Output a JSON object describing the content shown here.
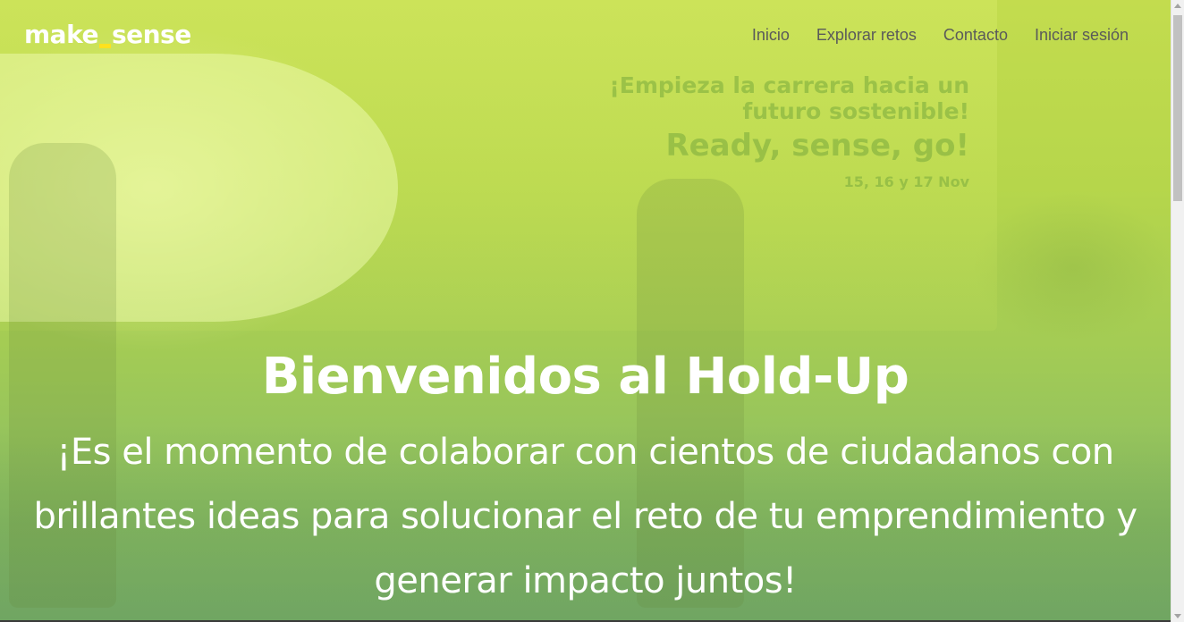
{
  "header": {
    "logo": {
      "part1": "make",
      "part2": "sense"
    },
    "nav": [
      {
        "label": "Inicio"
      },
      {
        "label": "Explorar retos"
      },
      {
        "label": "Contacto"
      },
      {
        "label": "Iniciar sesión"
      }
    ]
  },
  "hero": {
    "title": "Bienvenidos al Hold-Up",
    "subtitle": "¡Es el momento de colaborar con cientos de ciudadanos con brillantes ideas para solucionar el reto de tu emprendimiento y generar impacto juntos!",
    "background_photo_text": {
      "line1": "¡Empieza la carrera hacia un futuro sostenible!",
      "line2": "Ready, sense, go!",
      "line3": "15, 16 y 17 Nov"
    }
  },
  "colors": {
    "overlay_top": "#c3dc4e",
    "overlay_bottom": "#7eb46c",
    "logo_accent": "#ffe11f",
    "nav_text": "#5a5a5a",
    "hero_text": "#ffffff"
  }
}
